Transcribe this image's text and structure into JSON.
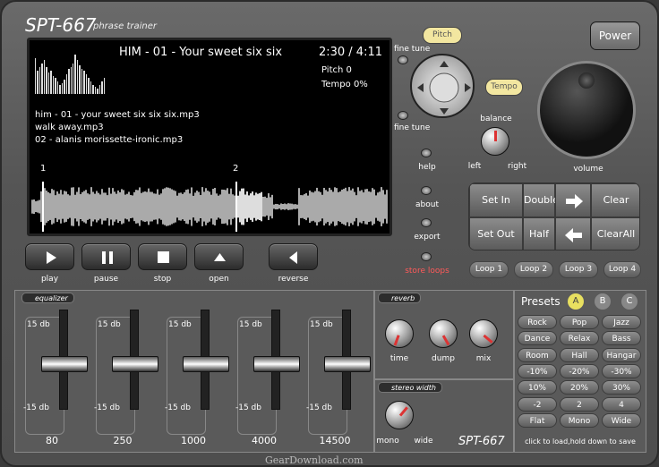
{
  "app": {
    "title": "SPT-667",
    "subtitle": "phrase trainer"
  },
  "screen": {
    "track": "HIM - 01 - Your sweet six six",
    "time": "2:30 / 4:11",
    "pitch": "Pitch 0",
    "tempo": "Tempo 0%",
    "playlist": [
      "him - 01 - your sweet six six six.mp3",
      "walk away.mp3",
      "02 - alanis morissette-ironic.mp3"
    ],
    "markers": [
      "1",
      "2"
    ]
  },
  "transport": {
    "play": "play",
    "pause": "pause",
    "stop": "stop",
    "open": "open",
    "reverse": "reverse"
  },
  "side": {
    "fine_tune": "fine tune",
    "help": "help",
    "about": "about",
    "export": "export",
    "store_loops": "store loops"
  },
  "pitch_label": "Pitch",
  "tempo_label": "Tempo",
  "power": "Power",
  "balance": {
    "label": "balance",
    "left": "left",
    "right": "right"
  },
  "volume": "volume",
  "loopgrid": {
    "set_in": "Set In",
    "double": "Double",
    "clear": "Clear",
    "set_out": "Set Out",
    "half": "Half",
    "clear_all": "ClearAll"
  },
  "loops": [
    "Loop 1",
    "Loop 2",
    "Loop 3",
    "Loop 4"
  ],
  "equalizer": {
    "title": "equalizer",
    "top": "15 db",
    "bottom": "-15 db",
    "bands": [
      "80",
      "250",
      "1000",
      "4000",
      "14500"
    ],
    "levels": [
      0.5,
      0.5,
      0.5,
      0.5,
      0.5
    ]
  },
  "reverb": {
    "title": "reverb",
    "knobs": [
      "time",
      "dump",
      "mix"
    ]
  },
  "stereo": {
    "title": "stereo width",
    "mono": "mono",
    "wide": "wide"
  },
  "brand": "SPT-667",
  "presets": {
    "title": "Presets",
    "tabs": [
      "A",
      "B",
      "C"
    ],
    "items": [
      "Rock",
      "Pop",
      "Jazz",
      "Dance",
      "Relax",
      "Bass",
      "Room",
      "Hall",
      "Hangar",
      "-10%",
      "-20%",
      "-30%",
      "10%",
      "20%",
      "30%",
      "-2",
      "2",
      "4",
      "Flat",
      "Mono",
      "Wide"
    ],
    "hint": "click to load,hold down to save"
  },
  "watermark": "GearDownload.com",
  "colors": {
    "accent": "#f0c020",
    "store": "#ff5a5a",
    "yellow_btn": "#f2e6a0"
  }
}
